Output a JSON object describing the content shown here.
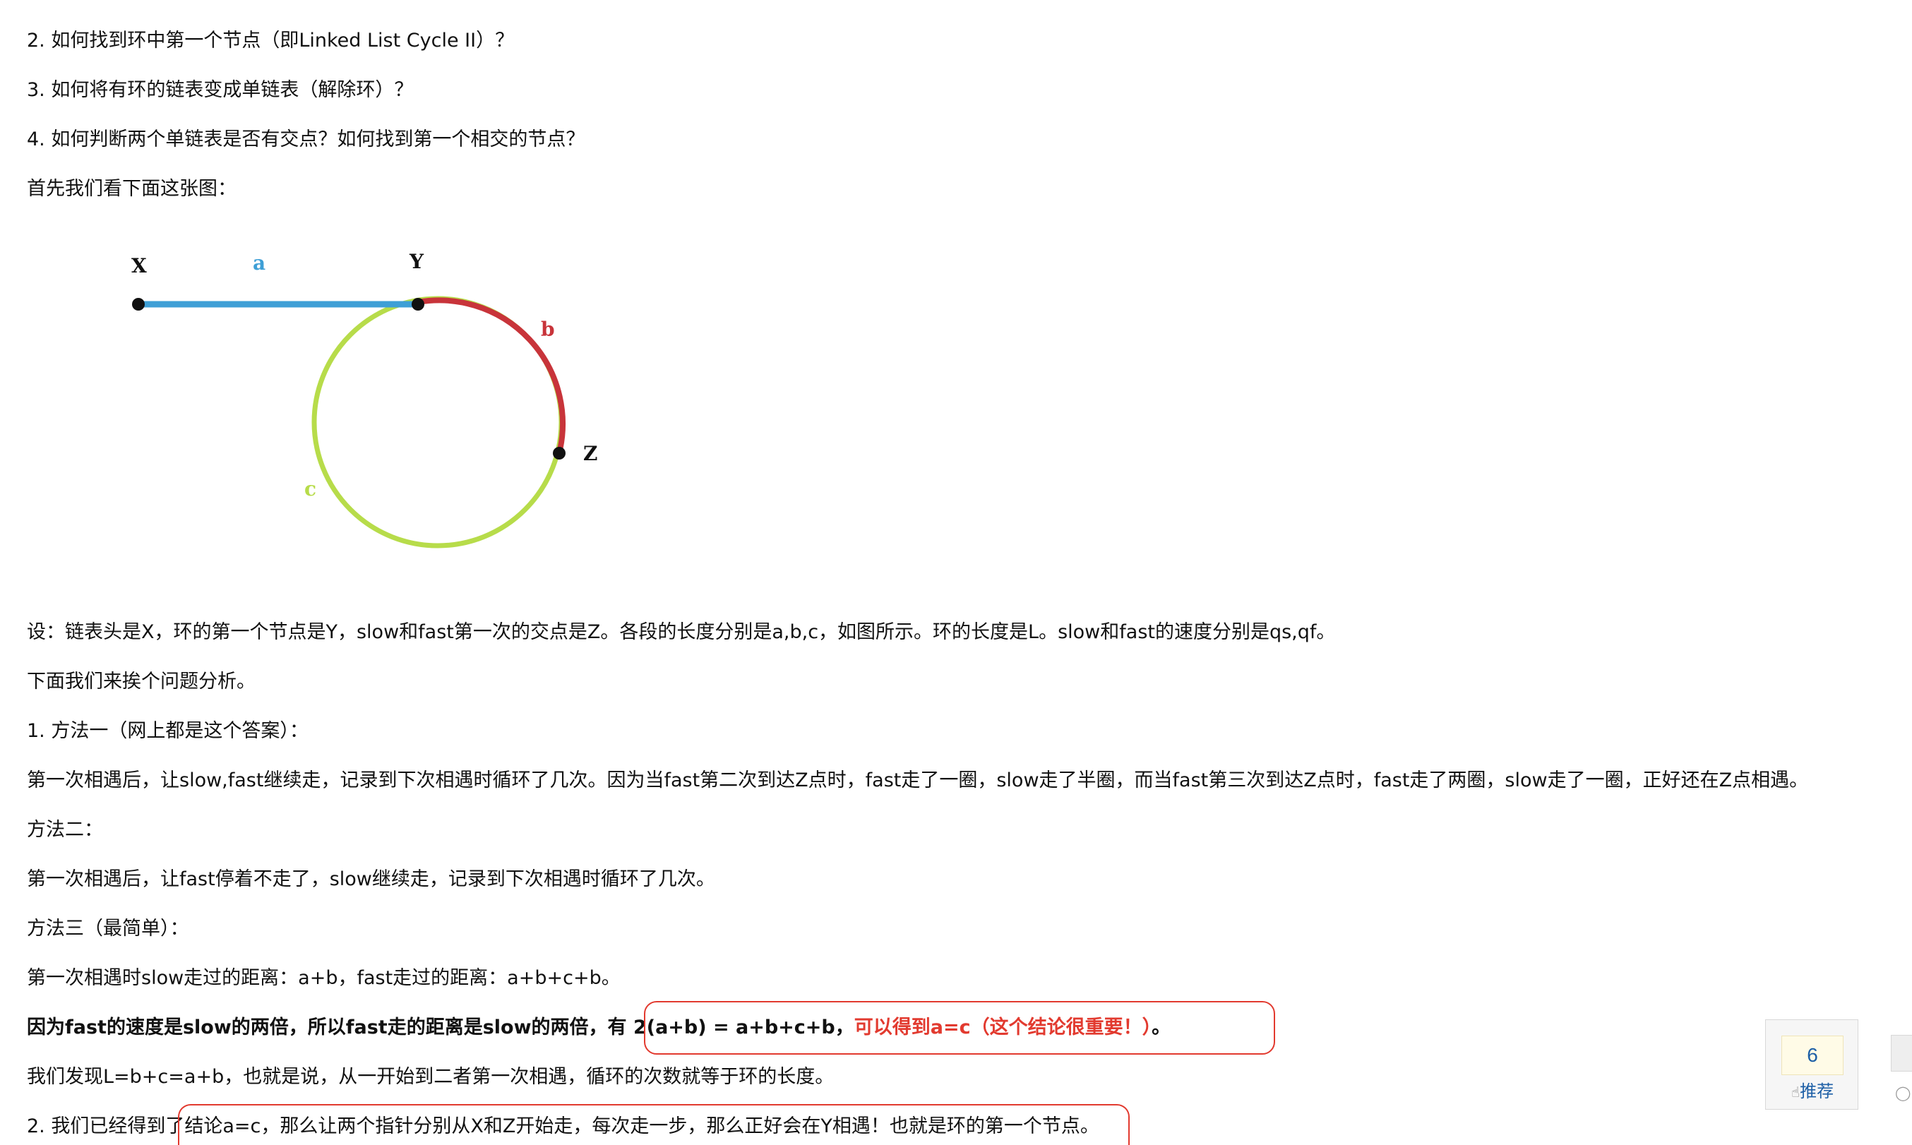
{
  "article": {
    "q2": "2. 如何找到环中第一个节点（即Linked List Cycle II）？",
    "q3": "3. 如何将有环的链表变成单链表（解除环）？",
    "q4": "4. 如何判断两个单链表是否有交点？如何找到第一个相交的节点？",
    "intro": "首先我们看下面这张图：",
    "setup": "设：链表头是X，环的第一个节点是Y，slow和fast第一次的交点是Z。各段的长度分别是a,b,c，如图所示。环的长度是L。slow和fast的速度分别是qs,qf。",
    "analyze": "下面我们来挨个问题分析。",
    "method1_title": "1. 方法一（网上都是这个答案）：",
    "method1_body": "第一次相遇后，让slow,fast继续走，记录到下次相遇时循环了几次。因为当fast第二次到达Z点时，fast走了一圈，slow走了半圈，而当fast第三次到达Z点时，fast走了两圈，slow走了一圈，正好还在Z点相遇。",
    "method2_title": "方法二：",
    "method2_body": "第一次相遇后，让fast停着不走了，slow继续走，记录到下次相遇时循环了几次。",
    "method3_title": "方法三（最简单）：",
    "distance": "第一次相遇时slow走过的距离：a+b，fast走过的距离：a+b+c+b。",
    "bold_prefix": "因为fast的速度是slow的两倍，所以fast走的距离是slow的两倍，有 ",
    "bold_formula": "2(a+b) = a+b+c+b，",
    "red_conclusion": "可以得到a=c（这个结论很重要！）",
    "period": "。",
    "loop_len": "我们发现L=b+c=a+b，也就是说，从一开始到二者第一次相遇，循环的次数就等于环的长度。",
    "answer2": "2. 我们已经得到了结论a=c，那么让两个指针分别从X和Z开始走，每次走一步，那么正好会在Y相遇！也就是环的第一个节点。"
  },
  "diagram": {
    "label_x": "X",
    "label_a": "a",
    "label_y": "Y",
    "label_b": "b",
    "label_z": "Z",
    "label_c": "c",
    "color_a": "#3e9fd6",
    "color_b": "#c8343a",
    "color_c": "#b7dc4a"
  },
  "recommend": {
    "count": "6",
    "label": "推荐",
    "thumb_icon": "thumbs-up-icon"
  },
  "side": {
    "icon": "comment-icon"
  },
  "colors": {
    "text": "#111111",
    "accent_red": "#e23a2f",
    "link_blue": "#1d5fa6"
  }
}
